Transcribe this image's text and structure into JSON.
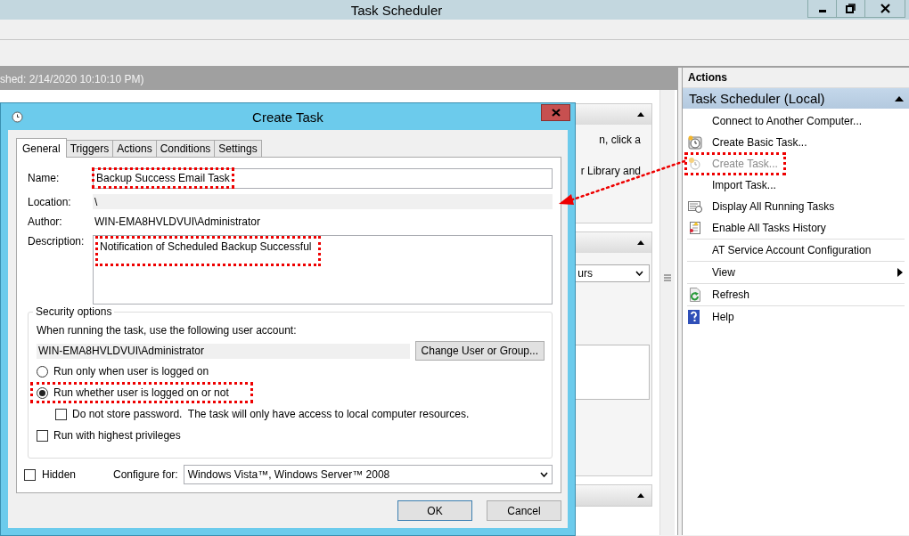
{
  "window": {
    "title": "Task Scheduler"
  },
  "main_pane": {
    "header": "shed: 2/14/2020 10:10:10 PM)",
    "text_1": "n, click a",
    "text_2": "r Library and",
    "dropdown_value": "urs"
  },
  "actions_pane": {
    "title": "Actions",
    "group": {
      "title": "Task Scheduler (Local)",
      "expanded": true
    },
    "items": [
      {
        "label": "Connect to Another Computer...",
        "kind": "plain",
        "disabled": false,
        "highlighted": false,
        "submenu": false,
        "separator_after": false
      },
      {
        "label": "Create Basic Task...",
        "kind": "basic",
        "disabled": false,
        "highlighted": false,
        "submenu": false,
        "separator_after": false
      },
      {
        "label": "Create Task...",
        "kind": "create",
        "disabled": true,
        "highlighted": true,
        "submenu": false,
        "separator_after": false
      },
      {
        "label": "Import Task...",
        "kind": "plain",
        "disabled": false,
        "highlighted": false,
        "submenu": false,
        "separator_after": false
      },
      {
        "label": "Display All Running Tasks",
        "kind": "running",
        "disabled": false,
        "highlighted": false,
        "submenu": false,
        "separator_after": false
      },
      {
        "label": "Enable All Tasks History",
        "kind": "history",
        "disabled": false,
        "highlighted": false,
        "submenu": false,
        "separator_after": true
      },
      {
        "label": "AT Service Account Configuration",
        "kind": "plain",
        "disabled": false,
        "highlighted": false,
        "submenu": false,
        "separator_after": true
      },
      {
        "label": "View",
        "kind": "plain",
        "disabled": false,
        "highlighted": false,
        "submenu": true,
        "separator_after": true
      },
      {
        "label": "Refresh",
        "kind": "refresh",
        "disabled": false,
        "highlighted": false,
        "submenu": false,
        "separator_after": true
      },
      {
        "label": "Help",
        "kind": "help",
        "disabled": false,
        "highlighted": false,
        "submenu": false,
        "separator_after": false
      }
    ]
  },
  "dialog": {
    "title": "Create Task",
    "tabs": [
      {
        "label": "General",
        "selected": true
      },
      {
        "label": "Triggers",
        "selected": false
      },
      {
        "label": "Actions",
        "selected": false
      },
      {
        "label": "Conditions",
        "selected": false
      },
      {
        "label": "Settings",
        "selected": false
      }
    ],
    "rows": [
      {
        "kind": "input",
        "label": "Name:",
        "value": "Backup Success Email Task",
        "highlighted": true
      },
      {
        "kind": "readonly",
        "label": "Location:",
        "value": "\\",
        "highlighted": false
      },
      {
        "kind": "text",
        "label": "Author:",
        "value": "WIN-EMA8HVLDVUI\\Administrator",
        "highlighted": false
      },
      {
        "kind": "textarea",
        "label": "Description:",
        "value": "Notification of Scheduled Backup Successful",
        "highlighted": true
      }
    ],
    "security": {
      "title": "Security options",
      "prompt": "When running the task, use the following user account:",
      "account": "WIN-EMA8HVLDVUI\\Administrator",
      "change_button": "Change User or Group...",
      "options": [
        {
          "kind": "radio",
          "label": "Run only when user is logged on",
          "selected": false,
          "highlighted": false
        },
        {
          "kind": "radio",
          "label": "Run whether user is logged on or not",
          "selected": true,
          "highlighted": true,
          "children": [
            {
              "kind": "checkbox",
              "label": "Do not store password.  The task will only have access to local computer resources.",
              "checked": false,
              "highlighted": false
            }
          ]
        },
        {
          "kind": "checkbox",
          "label": "Run with highest privileges",
          "checked": false,
          "highlighted": false
        }
      ]
    },
    "hidden": {
      "label": "Hidden",
      "checked": false
    },
    "configure": {
      "label": "Configure for:",
      "value": "Windows Vista™, Windows Server™ 2008"
    },
    "buttons": [
      {
        "label": "OK",
        "default": true
      },
      {
        "label": "Cancel",
        "default": false
      }
    ]
  }
}
